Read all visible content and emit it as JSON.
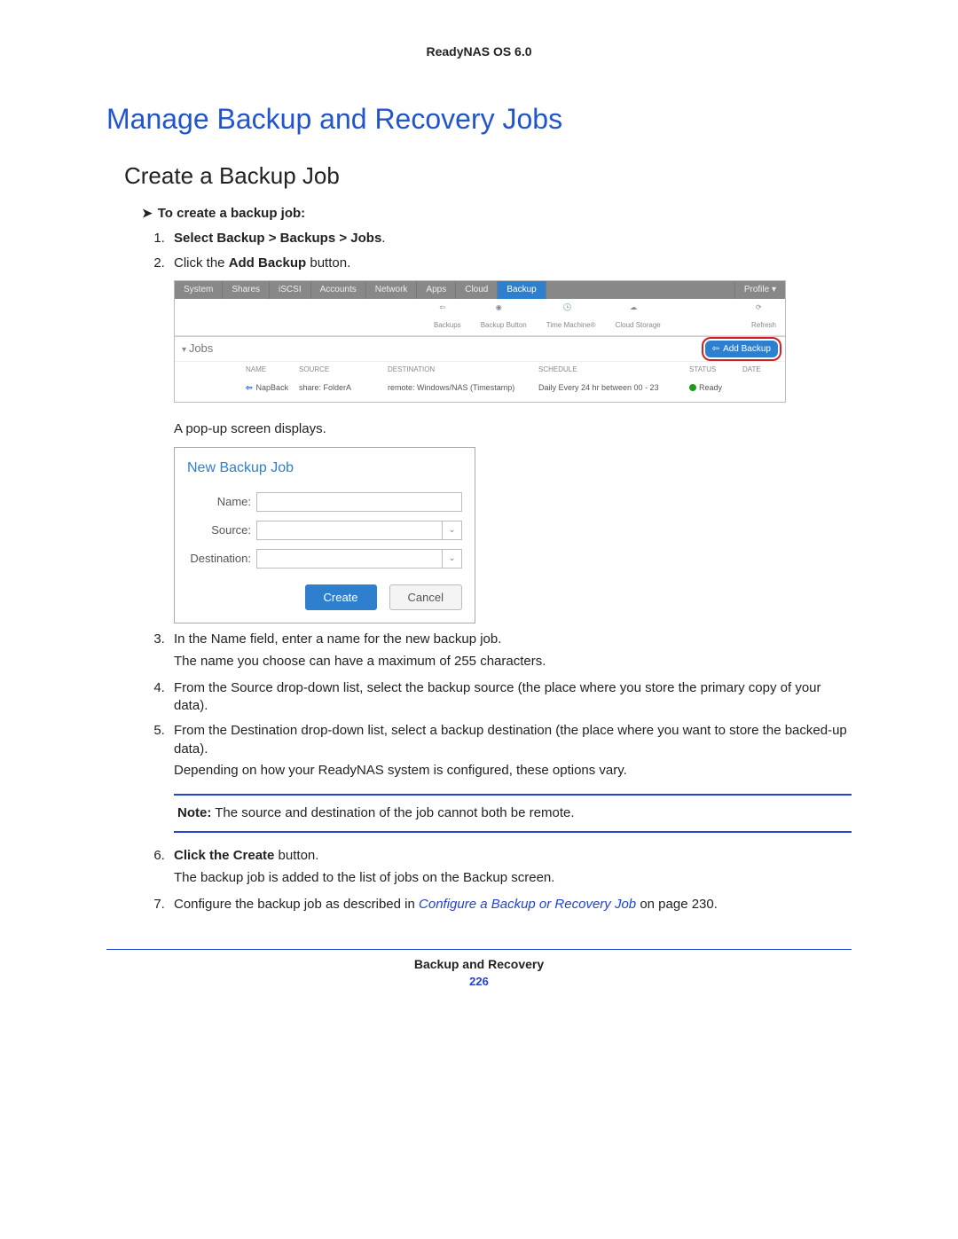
{
  "header": {
    "product": "ReadyNAS OS 6.0"
  },
  "h1": "Manage Backup and Recovery Jobs",
  "h2": "Create a Backup Job",
  "task_title": "To create a backup job:",
  "steps": {
    "s1a": "Select ",
    "s1b": "Backup > Backups > Jobs",
    "s1c": ".",
    "s2a": "Click the ",
    "s2b": "Add Backup",
    "s2c": " button.",
    "popup_intro": "A pop-up screen displays.",
    "s3a": "In the Name field, enter a name for the new backup job.",
    "s3b": "The name you choose can have a maximum of 255 characters.",
    "s4": "From the Source drop-down list, select the backup source (the place where you store the primary copy of your data).",
    "s5a": "From the Destination drop-down list, select a backup destination (the place where you want to store the backed-up data).",
    "s5b": "Depending on how your ReadyNAS system is configured, these options vary.",
    "s6a": "Click the ",
    "s6b": "Create",
    "s6c": " button.",
    "s6d": "The backup job is added to the list of jobs on the Backup screen.",
    "s7a": "Configure the backup job as described in ",
    "s7link": "Configure a Backup or Recovery Job",
    "s7b": " on page 230."
  },
  "note": {
    "label": "Note:",
    "text": " The source and destination of the job cannot both be remote."
  },
  "app": {
    "tabs": [
      "System",
      "Shares",
      "iSCSI",
      "Accounts",
      "Network",
      "Apps",
      "Cloud",
      "Backup"
    ],
    "profile": "Profile ▾",
    "toolbar": {
      "backups": "Backups",
      "backup_button": "Backup Button",
      "time_machine": "Time Machine®",
      "cloud_storage": "Cloud Storage",
      "refresh": "Refresh"
    },
    "jobs_title": "Jobs",
    "add_backup": "Add Backup",
    "columns": {
      "name": "NAME",
      "source": "SOURCE",
      "destination": "DESTINATION",
      "schedule": "SCHEDULE",
      "status": "STATUS",
      "date": "DATE"
    },
    "row": {
      "name": "NapBack",
      "source": "share: FolderA",
      "destination": "remote: Windows/NAS (Timestamp)",
      "schedule": "Daily Every 24 hr between 00 - 23",
      "status": "Ready"
    }
  },
  "dialog": {
    "title": "New Backup Job",
    "name_label": "Name:",
    "source_label": "Source:",
    "dest_label": "Destination:",
    "create": "Create",
    "cancel": "Cancel"
  },
  "footer": {
    "section": "Backup and Recovery",
    "page": "226"
  }
}
